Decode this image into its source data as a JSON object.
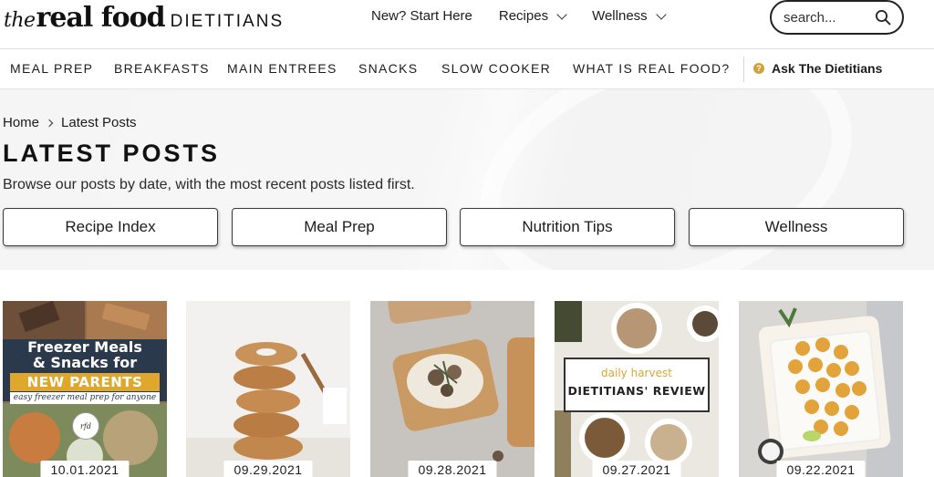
{
  "brand": {
    "the": "the",
    "real_food": "real food",
    "dietitians": "DIETITIANS"
  },
  "topnav": {
    "items": [
      {
        "label": "New? Start Here",
        "has_dropdown": false
      },
      {
        "label": "Recipes",
        "has_dropdown": true
      },
      {
        "label": "Wellness",
        "has_dropdown": true
      }
    ]
  },
  "search": {
    "placeholder": "search...",
    "icon": "search-icon"
  },
  "catnav": {
    "items": [
      "MEAL PREP",
      "BREAKFASTS",
      "MAIN ENTREES",
      "SNACKS",
      "SLOW COOKER",
      "WHAT IS REAL FOOD?"
    ],
    "ask_label": "Ask The Dietitians",
    "ask_icon": "question-icon",
    "ask_icon_color": "#d2a23a"
  },
  "hero": {
    "breadcrumb": {
      "home": "Home",
      "current": "Latest Posts"
    },
    "title": "LATEST POSTS",
    "description": "Browse our posts by date, with the most recent posts listed first.",
    "buttons": [
      "Recipe Index",
      "Meal Prep",
      "Nutrition Tips",
      "Wellness"
    ]
  },
  "posts": [
    {
      "date": "10.01.2021",
      "overlay": {
        "title_line1": "Freezer Meals",
        "title_line2": "& Snacks for",
        "subtitle": "NEW PARENTS",
        "tagline": "easy freezer meal prep for anyone",
        "badge": "rfd"
      }
    },
    {
      "date": "09.29.2021"
    },
    {
      "date": "09.28.2021"
    },
    {
      "date": "09.27.2021",
      "overlay": {
        "line1": "daily harvest",
        "line2": "DIETITIANS' REVIEW"
      }
    },
    {
      "date": "09.22.2021"
    }
  ],
  "colors": {
    "accent_gold": "#e0a72d",
    "navy": "#2a3a4c",
    "text": "#1c1c1c"
  }
}
